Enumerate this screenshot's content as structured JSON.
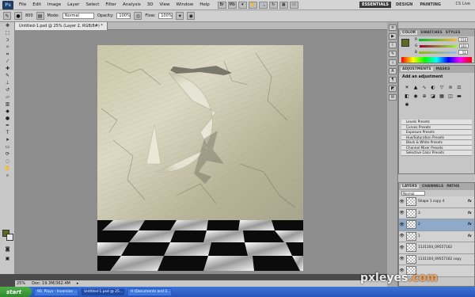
{
  "menubar": {
    "logo": "Ps",
    "items": [
      "File",
      "Edit",
      "Image",
      "Layer",
      "Select",
      "Filter",
      "Analysis",
      "3D",
      "View",
      "Window",
      "Help"
    ],
    "workspaces": [
      "ESSENTIALS",
      "DESIGN",
      "PAINTING"
    ],
    "cs_live": "CS Live"
  },
  "options": {
    "size": "800",
    "mode_label": "Mode:",
    "mode_value": "Normal",
    "opacity_label": "Opacity:",
    "opacity_value": "100%",
    "flow_label": "Flow:",
    "flow_value": "100%"
  },
  "document": {
    "tab_title": "Untitled-1.psd @ 25% (Layer 2, RGB/8#) *",
    "zoom": "25%",
    "doc_info": "Doc: 19.3M/362.4M"
  },
  "color_panel": {
    "tabs": [
      "COLOR",
      "SWATCHES",
      "STYLES"
    ],
    "values": [
      "150",
      "183",
      "51"
    ]
  },
  "adjustments": {
    "tabs": [
      "ADJUSTMENTS",
      "MASKS"
    ],
    "heading": "Add an adjustment",
    "presets": [
      "Levels Presets",
      "Curves Presets",
      "Exposure Presets",
      "Hue/Saturation Presets",
      "Black & White Presets",
      "Channel Mixer Presets",
      "Selective Color Presets"
    ]
  },
  "layers": {
    "tabs": [
      "LAYERS",
      "CHANNELS",
      "PATHS"
    ],
    "blend": "Normal",
    "rows": [
      {
        "name": "Shape 1 copy 4",
        "fx": "fx"
      },
      {
        "name": "3",
        "fx": "fx"
      },
      {
        "name": "2",
        "fx": "fx"
      },
      {
        "name": "1",
        "fx": "fx"
      },
      {
        "name": "1131104_09557162",
        "fx": ""
      },
      {
        "name": "1131104_09557162 copy",
        "fx": ""
      },
      {
        "name": "",
        "fx": ""
      }
    ]
  },
  "taskbar": {
    "start": "start",
    "tasks": [
      "90. Pixys - Inversion ...",
      "Untitled-1.psd @ 25...",
      "H:\\Documents and S..."
    ]
  },
  "watermark": {
    "main": "pxleyes",
    "suffix": ".com"
  }
}
